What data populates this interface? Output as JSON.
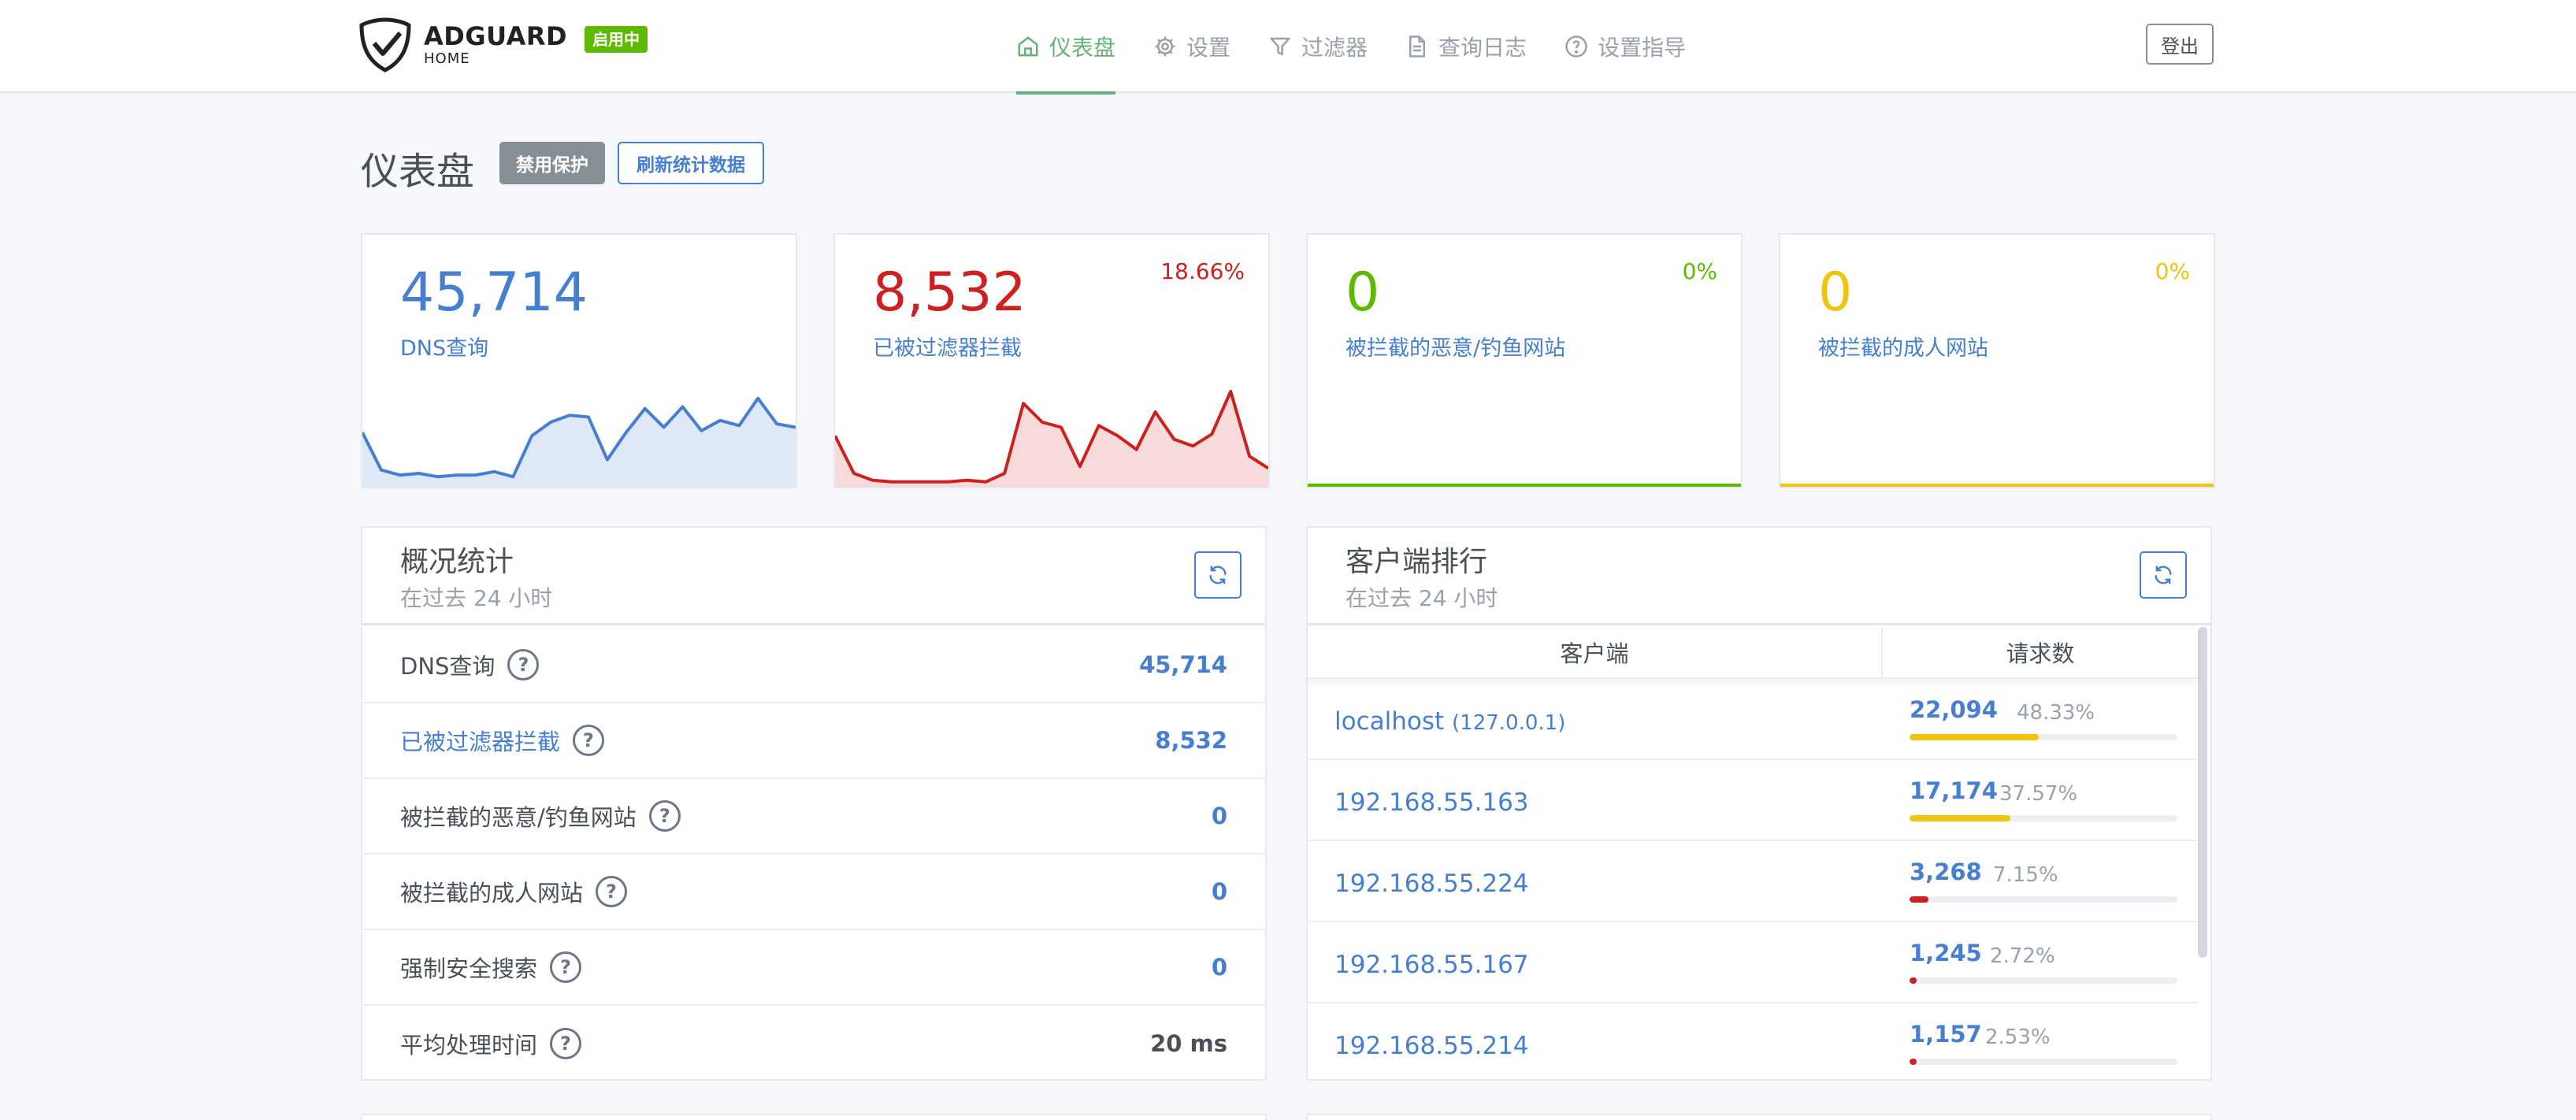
{
  "header": {
    "logo_main": "ADGUARD",
    "logo_sub": "HOME",
    "status_badge": "启用中",
    "nav": [
      {
        "label": "仪表盘",
        "icon": "home-icon",
        "active": true
      },
      {
        "label": "设置",
        "icon": "gear-icon",
        "active": false
      },
      {
        "label": "过滤器",
        "icon": "filter-icon",
        "active": false
      },
      {
        "label": "查询日志",
        "icon": "document-icon",
        "active": false
      },
      {
        "label": "设置指导",
        "icon": "help-circle-icon",
        "active": false
      }
    ],
    "logout": "登出"
  },
  "page": {
    "title": "仪表盘",
    "disable_button": "禁用保护",
    "refresh_button": "刷新统计数据"
  },
  "stats": [
    {
      "value": "45,714",
      "label": "DNS查询",
      "percent": "",
      "color": "#467fcf",
      "trend": [
        30,
        8,
        5,
        6,
        4,
        5,
        5,
        7,
        4,
        28,
        36,
        40,
        39,
        14,
        30,
        44,
        33,
        45,
        31,
        37,
        34,
        50,
        35,
        33
      ]
    },
    {
      "value": "8,532",
      "label": "已被过滤器拦截",
      "percent": "18.66%",
      "color": "#cd201f",
      "trend": [
        28,
        6,
        2,
        1,
        1,
        1,
        1,
        2,
        1,
        6,
        47,
        36,
        33,
        10,
        34,
        28,
        20,
        42,
        26,
        22,
        29,
        54,
        16,
        9
      ]
    },
    {
      "value": "0",
      "label": "被拦截的恶意/钓鱼网站",
      "percent": "0%",
      "color": "#5eba00",
      "trend": []
    },
    {
      "value": "0",
      "label": "被拦截的成人网站",
      "percent": "0%",
      "color": "#f1c40f",
      "trend": []
    }
  ],
  "overview": {
    "title": "概况统计",
    "subtitle": "在过去 24 小时",
    "rows": [
      {
        "label": "DNS查询",
        "value": "45,714",
        "link": false
      },
      {
        "label": "已被过滤器拦截",
        "value": "8,532",
        "link": true
      },
      {
        "label": "被拦截的恶意/钓鱼网站",
        "value": "0",
        "link": false
      },
      {
        "label": "被拦截的成人网站",
        "value": "0",
        "link": false
      },
      {
        "label": "强制安全搜索",
        "value": "0",
        "link": false
      },
      {
        "label": "平均处理时间",
        "value": "20 ms",
        "link": false
      }
    ],
    "help_glyph": "?"
  },
  "clients": {
    "title": "客户端排行",
    "subtitle": "在过去 24 小时",
    "col_client": "客户端",
    "col_requests": "请求数",
    "rows": [
      {
        "name": "localhost",
        "ip": "(127.0.0.1)",
        "count": "22,094",
        "percent": "48.33%",
        "ratio": 0.4833,
        "color": "#f1c40f"
      },
      {
        "name": "192.168.55.163",
        "ip": "",
        "count": "17,174",
        "percent": "37.57%",
        "ratio": 0.3757,
        "color": "#f1c40f"
      },
      {
        "name": "192.168.55.224",
        "ip": "",
        "count": "3,268",
        "percent": "7.15%",
        "ratio": 0.0715,
        "color": "#cd201f"
      },
      {
        "name": "192.168.55.167",
        "ip": "",
        "count": "1,245",
        "percent": "2.72%",
        "ratio": 0.0272,
        "color": "#cd201f"
      },
      {
        "name": "192.168.55.214",
        "ip": "",
        "count": "1,157",
        "percent": "2.53%",
        "ratio": 0.0253,
        "color": "#cd201f"
      }
    ]
  }
}
